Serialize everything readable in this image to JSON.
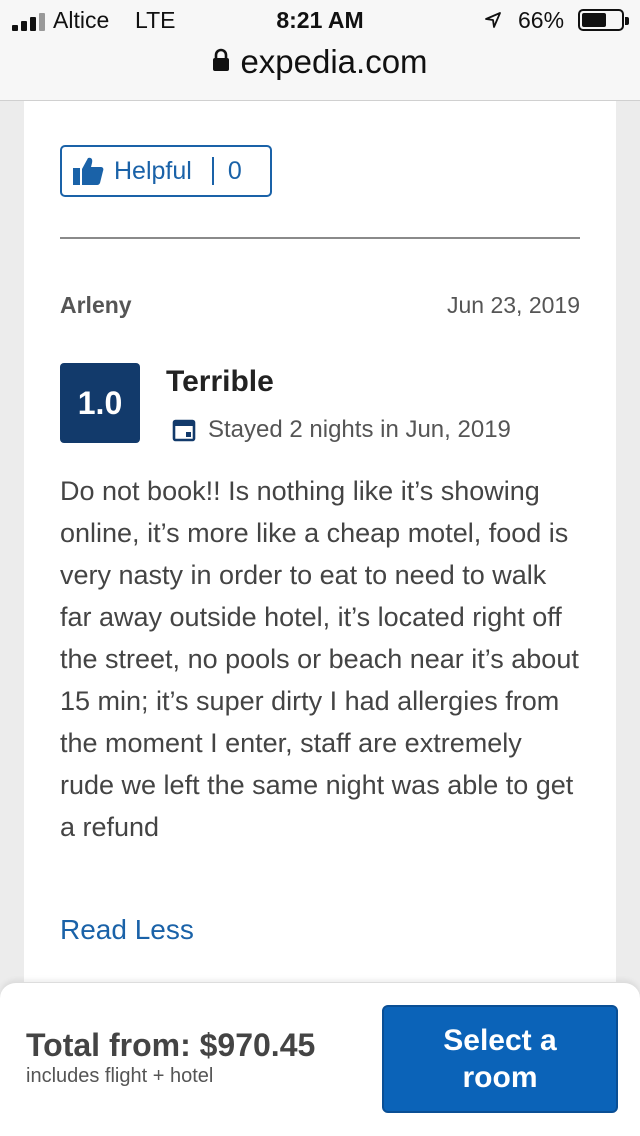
{
  "status_bar": {
    "carrier": "Altice",
    "network": "LTE",
    "time": "8:21 AM",
    "battery": "66%",
    "battery_level": 0.66
  },
  "browser": {
    "domain": "expedia.com"
  },
  "review": {
    "helpful_label": "Helpful",
    "helpful_count": "0",
    "author": "Arleny",
    "date": "Jun 23, 2019",
    "score": "1.0",
    "rating_label": "Terrible",
    "stay": "Stayed 2 nights in Jun, 2019",
    "text": "Do not book!! Is nothing like it’s showing online, it’s more like a cheap motel, food is very nasty in order to eat to need to walk far away outside hotel, it’s located right off the street, no pools or beach near it’s about 15 min; it’s super dirty I had allergies from the moment I enter, staff are extremely rude we left the same night was able to get a refund",
    "read_less": "Read Less"
  },
  "booking_bar": {
    "total": "Total from: $970.45",
    "includes": "includes flight + hotel",
    "button": "Select a room"
  },
  "colors": {
    "link_blue": "#1a62a8",
    "score_navy": "#123a6b",
    "button_blue": "#0b63b8"
  },
  "icons": [
    "signal-bars-icon",
    "location-arrow-icon",
    "battery-icon",
    "lock-icon",
    "thumbs-up-icon",
    "calendar-icon"
  ]
}
